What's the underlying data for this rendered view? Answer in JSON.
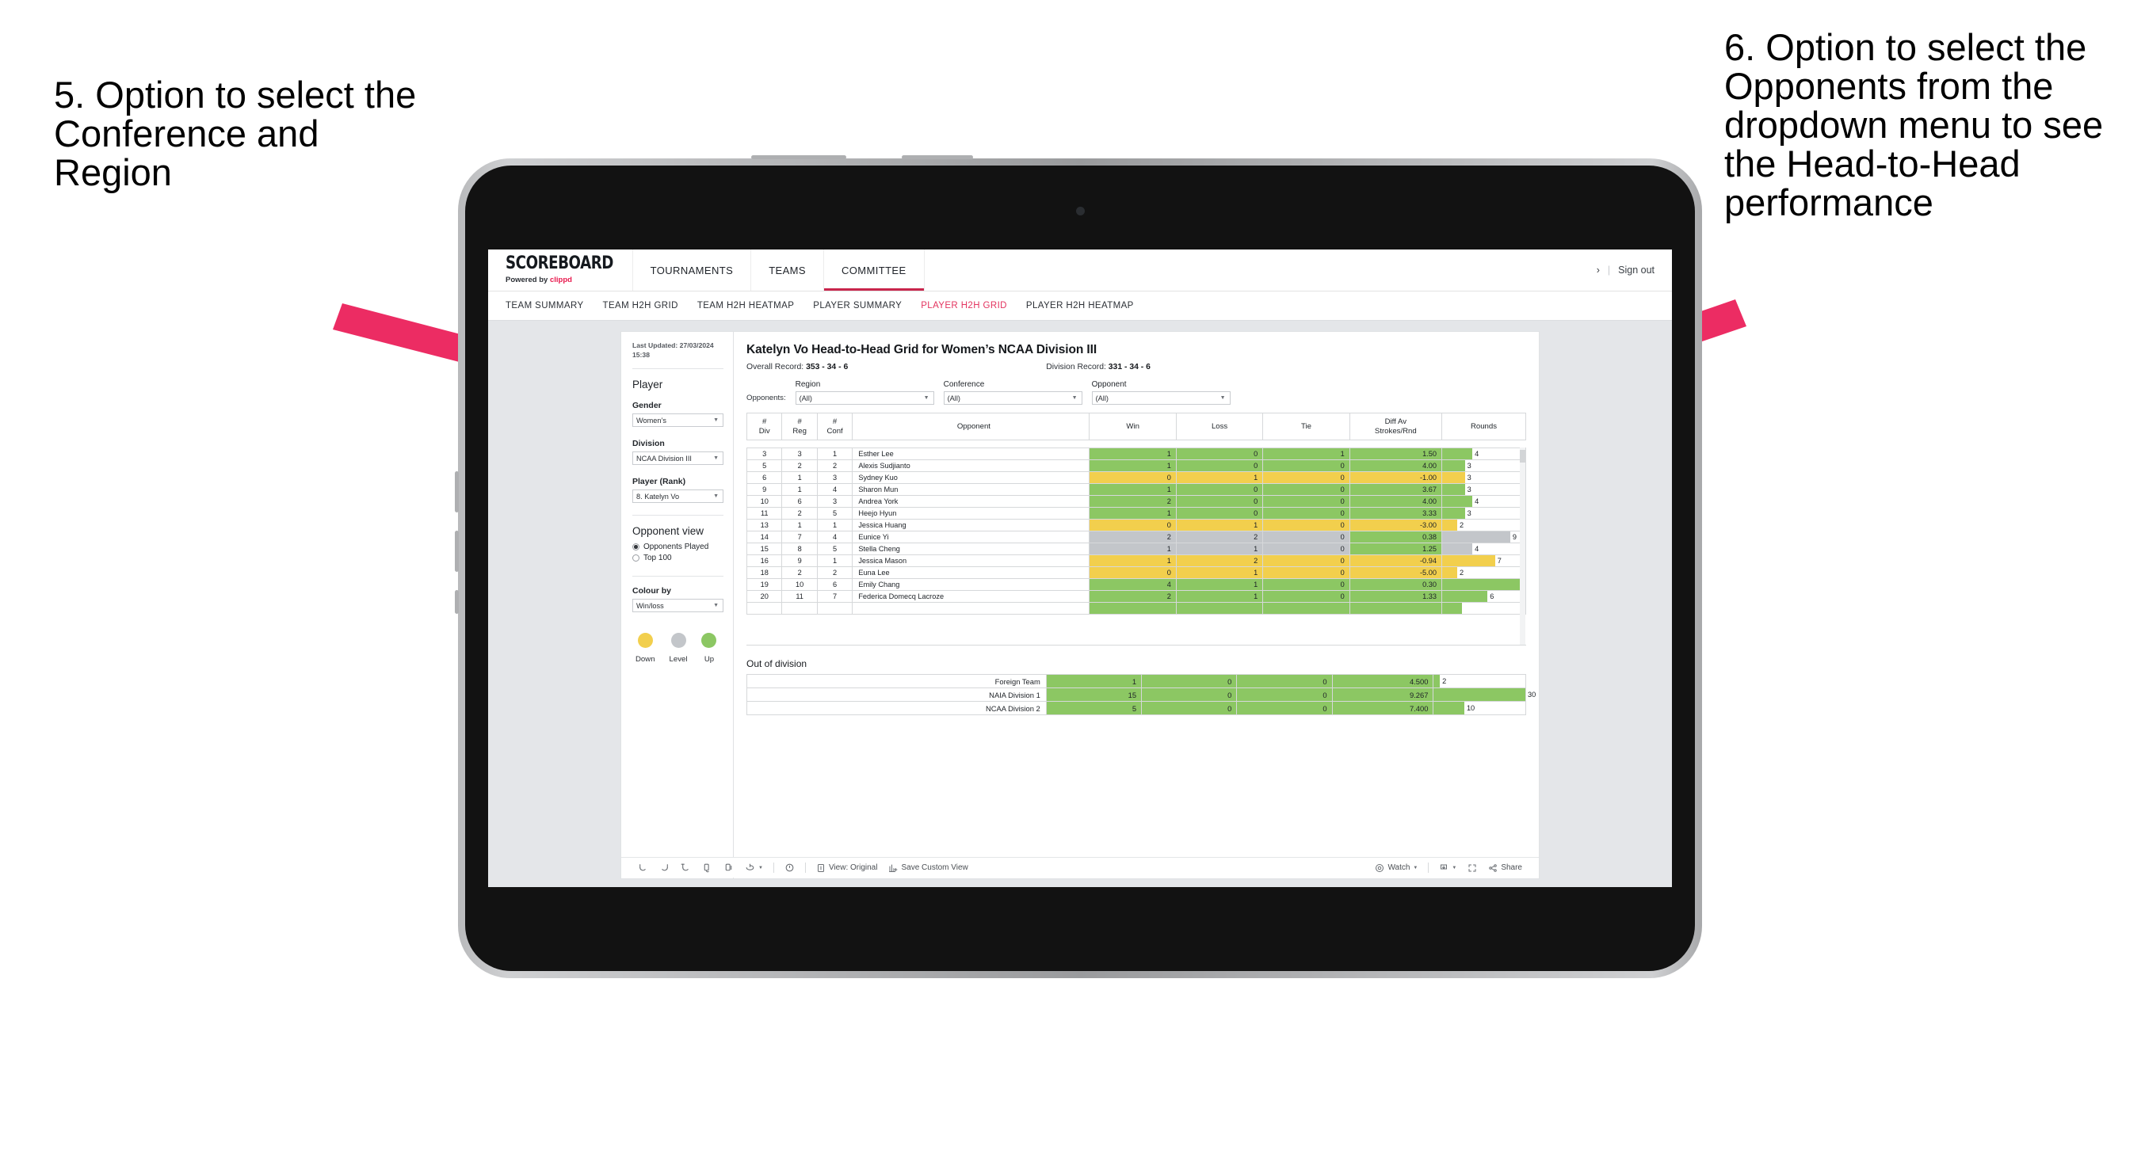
{
  "annotations": {
    "left": "5. Option to select the Conference and Region",
    "right": "6. Option to select the Opponents from the dropdown menu to see the Head-to-Head performance",
    "arrow_color": "#ec2c63"
  },
  "appbar": {
    "logo_main": "SCOREBOARD",
    "logo_sub_prefix": "Powered by ",
    "logo_sub_brand": "clippd",
    "nav": [
      {
        "label": "TOURNAMENTS",
        "active": false
      },
      {
        "label": "TEAMS",
        "active": false
      },
      {
        "label": "COMMITTEE",
        "active": true
      }
    ],
    "chevron": "›",
    "separator": "|",
    "signout": "Sign out"
  },
  "subnav": [
    {
      "label": "TEAM SUMMARY",
      "active": false
    },
    {
      "label": "TEAM H2H GRID",
      "active": false
    },
    {
      "label": "TEAM H2H HEATMAP",
      "active": false
    },
    {
      "label": "PLAYER SUMMARY",
      "active": false
    },
    {
      "label": "PLAYER H2H GRID",
      "active": true
    },
    {
      "label": "PLAYER H2H HEATMAP",
      "active": false
    }
  ],
  "pane": {
    "last_updated": "Last Updated: 27/03/2024 15:38",
    "heading": "Player",
    "gender_label": "Gender",
    "gender_value": "Women’s",
    "division_label": "Division",
    "division_value": "NCAA Division III",
    "player_label": "Player (Rank)",
    "player_value": "8. Katelyn Vo",
    "opponent_view_heading": "Opponent view",
    "opponent_view_options": [
      {
        "label": "Opponents Played",
        "selected": true
      },
      {
        "label": "Top 100",
        "selected": false
      }
    ],
    "colour_by_label": "Colour by",
    "colour_by_value": "Win/loss",
    "legend": [
      {
        "caption": "Down",
        "color": "#f2cf4d"
      },
      {
        "caption": "Level",
        "color": "#c3c6ca"
      },
      {
        "caption": "Up",
        "color": "#8cc763"
      }
    ]
  },
  "viz": {
    "title": "Katelyn Vo Head-to-Head Grid for Women’s NCAA Division III",
    "overall_record_label": "Overall Record:",
    "overall_record_value": "353 - 34 - 6",
    "division_record_label": "Division Record:",
    "division_record_value": "331 - 34 - 6",
    "filters_label": "Opponents:",
    "filters": [
      {
        "label": "Region",
        "value": "(All)"
      },
      {
        "label": "Conference",
        "value": "(All)"
      },
      {
        "label": "Opponent",
        "value": "(All)"
      }
    ],
    "columns": [
      "# Div",
      "# Reg",
      "# Conf",
      "Opponent",
      "Win",
      "Loss",
      "Tie",
      "Diff Av Strokes/Rnd",
      "Rounds"
    ],
    "out_of_division_title": "Out of division"
  },
  "chart_data": {
    "type": "table",
    "title": "Katelyn Vo Head-to-Head Grid for Women’s NCAA Division III",
    "columns": [
      "# Div",
      "# Reg",
      "# Conf",
      "Opponent",
      "Win",
      "Loss",
      "Tie",
      "Diff Av Strokes/Rnd",
      "Rounds"
    ],
    "rounds_max": 11,
    "colors": {
      "up": "#8cc763",
      "down": "#f2cf4d",
      "level": "#c3c6ca"
    },
    "rows": [
      {
        "div": "3",
        "reg": "3",
        "conf": "1",
        "opponent": "Esther Lee",
        "win": "1",
        "loss": "0",
        "tie": "1",
        "diff": "1.50",
        "rounds": "4",
        "state": "up"
      },
      {
        "div": "5",
        "reg": "2",
        "conf": "2",
        "opponent": "Alexis Sudjianto",
        "win": "1",
        "loss": "0",
        "tie": "0",
        "diff": "4.00",
        "rounds": "3",
        "state": "up"
      },
      {
        "div": "6",
        "reg": "1",
        "conf": "3",
        "opponent": "Sydney Kuo",
        "win": "0",
        "loss": "1",
        "tie": "0",
        "diff": "-1.00",
        "rounds": "3",
        "state": "down"
      },
      {
        "div": "9",
        "reg": "1",
        "conf": "4",
        "opponent": "Sharon Mun",
        "win": "1",
        "loss": "0",
        "tie": "0",
        "diff": "3.67",
        "rounds": "3",
        "state": "up"
      },
      {
        "div": "10",
        "reg": "6",
        "conf": "3",
        "opponent": "Andrea York",
        "win": "2",
        "loss": "0",
        "tie": "0",
        "diff": "4.00",
        "rounds": "4",
        "state": "up"
      },
      {
        "div": "11",
        "reg": "2",
        "conf": "5",
        "opponent": "Heejo Hyun",
        "win": "1",
        "loss": "0",
        "tie": "0",
        "diff": "3.33",
        "rounds": "3",
        "state": "up"
      },
      {
        "div": "13",
        "reg": "1",
        "conf": "1",
        "opponent": "Jessica Huang",
        "win": "0",
        "loss": "1",
        "tie": "0",
        "diff": "-3.00",
        "rounds": "2",
        "state": "down"
      },
      {
        "div": "14",
        "reg": "7",
        "conf": "4",
        "opponent": "Eunice Yi",
        "win": "2",
        "loss": "2",
        "tie": "0",
        "diff": "0.38",
        "rounds": "9",
        "state": "level",
        "diff_state": "up"
      },
      {
        "div": "15",
        "reg": "8",
        "conf": "5",
        "opponent": "Stella Cheng",
        "win": "1",
        "loss": "1",
        "tie": "0",
        "diff": "1.25",
        "rounds": "4",
        "state": "level",
        "diff_state": "up"
      },
      {
        "div": "16",
        "reg": "9",
        "conf": "1",
        "opponent": "Jessica Mason",
        "win": "1",
        "loss": "2",
        "tie": "0",
        "diff": "-0.94",
        "rounds": "7",
        "state": "down"
      },
      {
        "div": "18",
        "reg": "2",
        "conf": "2",
        "opponent": "Euna Lee",
        "win": "0",
        "loss": "1",
        "tie": "0",
        "diff": "-5.00",
        "rounds": "2",
        "state": "down"
      },
      {
        "div": "19",
        "reg": "10",
        "conf": "6",
        "opponent": "Emily Chang",
        "win": "4",
        "loss": "1",
        "tie": "0",
        "diff": "0.30",
        "rounds": "11",
        "state": "up"
      },
      {
        "div": "20",
        "reg": "11",
        "conf": "7",
        "opponent": "Federica Domecq Lacroze",
        "win": "2",
        "loss": "1",
        "tie": "0",
        "diff": "1.33",
        "rounds": "6",
        "state": "up"
      }
    ],
    "out_of_division": {
      "rounds_max": 30,
      "rows": [
        {
          "name": "Foreign Team",
          "win": "1",
          "loss": "0",
          "tie": "0",
          "diff": "4.500",
          "rounds": "2",
          "state": "up"
        },
        {
          "name": "NAIA Division 1",
          "win": "15",
          "loss": "0",
          "tie": "0",
          "diff": "9.267",
          "rounds": "30",
          "state": "up"
        },
        {
          "name": "NCAA Division 2",
          "win": "5",
          "loss": "0",
          "tie": "0",
          "diff": "7.400",
          "rounds": "10",
          "state": "up"
        }
      ]
    }
  },
  "toolbar": {
    "view_label": "View: Original",
    "save_label": "Save Custom View",
    "watch_label": "Watch",
    "share_label": "Share"
  }
}
